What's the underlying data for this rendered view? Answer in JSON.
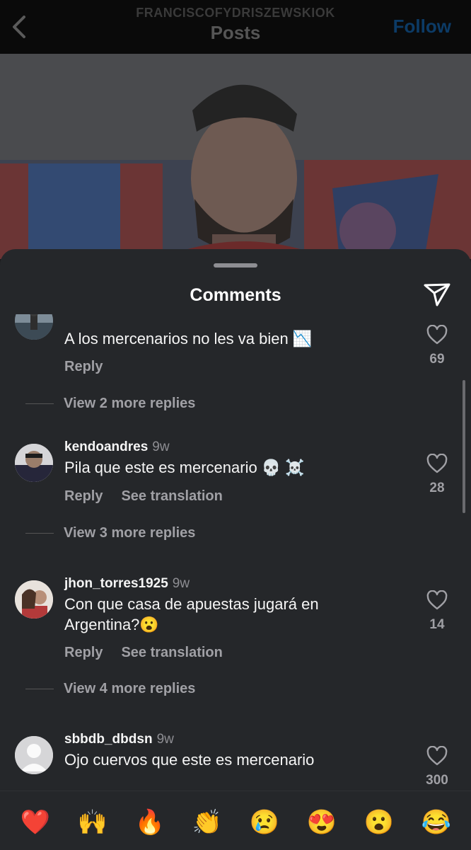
{
  "header": {
    "username": "FRANCISCOFYDRISZEWSKIOK",
    "title": "Posts",
    "follow_label": "Follow",
    "back_icon": "chevron-left-icon"
  },
  "sheet": {
    "title": "Comments",
    "share_icon": "paper-plane-icon"
  },
  "comments": [
    {
      "username": "",
      "time": "",
      "text": "A los mercenarios no les va bien 📉",
      "reply_label": "Reply",
      "translate_label": "",
      "likes": "69",
      "view_replies": "View 2 more replies"
    },
    {
      "username": "kendoandres",
      "time": "9w",
      "text": "Pila que este es mercenario 💀 ☠️",
      "reply_label": "Reply",
      "translate_label": "See translation",
      "likes": "28",
      "view_replies": "View 3 more replies"
    },
    {
      "username": "jhon_torres1925",
      "time": "9w",
      "text": "Con que casa de apuestas jugará en Argentina?😮",
      "reply_label": "Reply",
      "translate_label": "See translation",
      "likes": "14",
      "view_replies": "View 4 more replies"
    },
    {
      "username": "sbbdb_dbdsn",
      "time": "9w",
      "text": "Ojo cuervos que este es mercenario",
      "reply_label": "",
      "translate_label": "",
      "likes": "300",
      "view_replies": ""
    }
  ],
  "emoji_bar": [
    "❤️",
    "🙌",
    "🔥",
    "👏",
    "😢",
    "😍",
    "😮",
    "😂"
  ],
  "colors": {
    "follow": "#0c3b66",
    "sheet_bg": "#25272a",
    "secondary_text": "#a0a0a5"
  }
}
